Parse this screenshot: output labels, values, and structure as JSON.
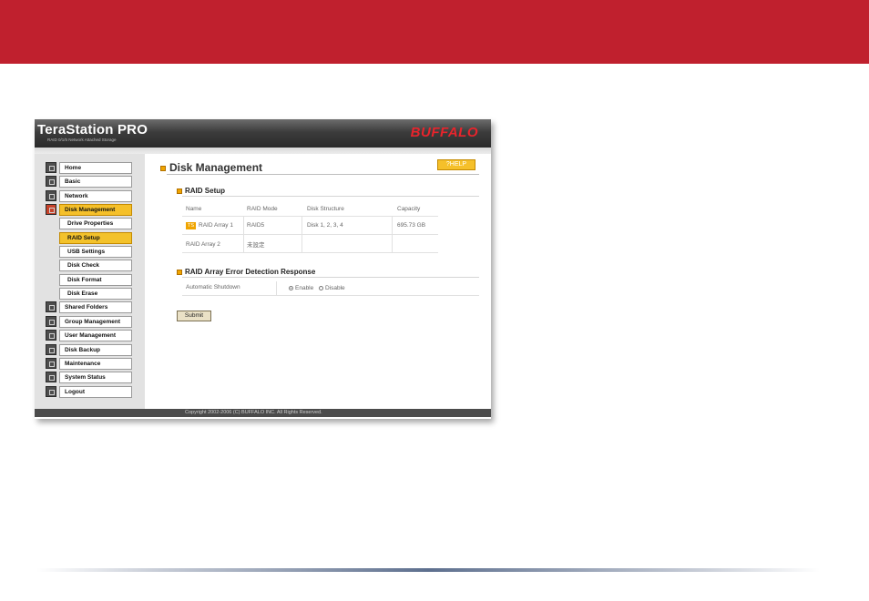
{
  "header": {
    "logo": "TeraStation PRO",
    "logo_sub": "RAID 0/1/5 Network Attached Storage",
    "brand": "BUFFALO"
  },
  "sidebar": {
    "items": [
      {
        "label": "Home",
        "type": "main",
        "active": false
      },
      {
        "label": "Basic",
        "type": "main",
        "active": false
      },
      {
        "label": "Network",
        "type": "main",
        "active": false
      },
      {
        "label": "Disk Management",
        "type": "main",
        "active": true
      },
      {
        "label": "Drive Properties",
        "type": "sub",
        "active": false
      },
      {
        "label": "RAID Setup",
        "type": "sub",
        "active": true
      },
      {
        "label": "USB Settings",
        "type": "sub",
        "active": false
      },
      {
        "label": "Disk Check",
        "type": "sub",
        "active": false
      },
      {
        "label": "Disk Format",
        "type": "sub",
        "active": false
      },
      {
        "label": "Disk Erase",
        "type": "sub",
        "active": false
      },
      {
        "label": "Shared Folders",
        "type": "main",
        "active": false
      },
      {
        "label": "Group Management",
        "type": "main",
        "active": false
      },
      {
        "label": "User Management",
        "type": "main",
        "active": false
      },
      {
        "label": "Disk Backup",
        "type": "main",
        "active": false
      },
      {
        "label": "Maintenance",
        "type": "main",
        "active": false
      },
      {
        "label": "System Status",
        "type": "main",
        "active": false
      },
      {
        "label": "Logout",
        "type": "main",
        "active": false
      }
    ]
  },
  "main": {
    "title": "Disk Management",
    "help": "?HELP",
    "raid_setup": {
      "title": "RAID Setup",
      "headers": [
        "Name",
        "RAID Mode",
        "Disk Structure",
        "Capacity"
      ],
      "rows": [
        {
          "tag": "TS",
          "name": "RAID Array 1",
          "mode": "RAID5",
          "disks": "Disk 1, 2, 3, 4",
          "capacity": "695.73 GB"
        },
        {
          "tag": "",
          "name": "RAID Array 2",
          "mode": "未設定",
          "disks": "",
          "capacity": ""
        }
      ]
    },
    "error_detection": {
      "title": "RAID Array Error Detection Response",
      "label": "Automatic Shutdown",
      "enable": "Enable",
      "disable": "Disable",
      "selected": "Enable"
    },
    "submit": "Submit"
  },
  "footer": {
    "copyright": "Copyright 2002-2006 (C) BUFFALO INC. All Rights Reserved."
  },
  "colors": {
    "banner": "#c0202e",
    "accent": "#f5c02a",
    "brand": "#e8242c"
  }
}
